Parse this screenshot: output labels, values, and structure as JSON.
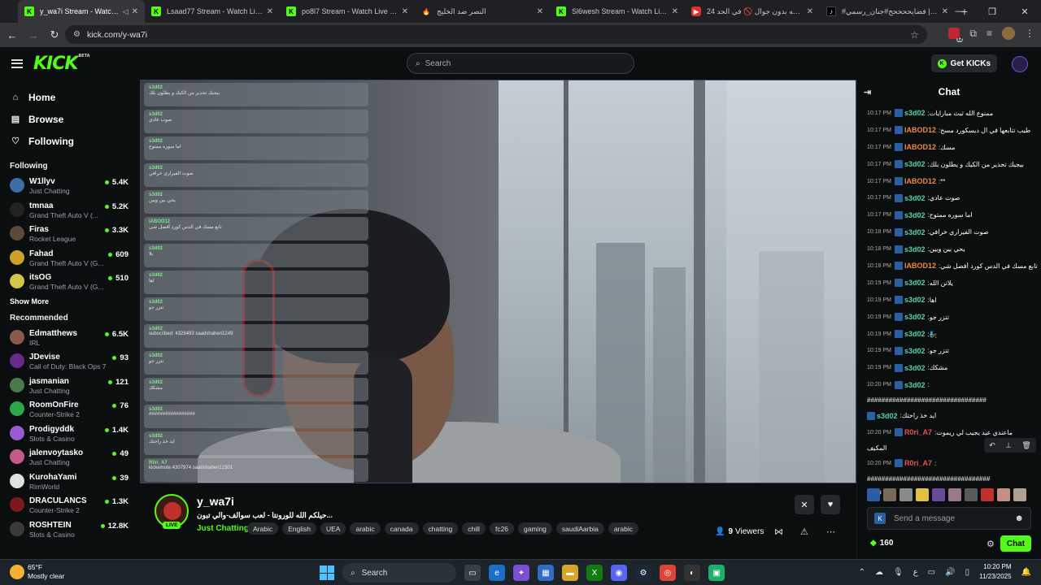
{
  "browser": {
    "tabs": [
      {
        "title": "y_wa7i Stream - Watch Live o",
        "icon": "kick-icon",
        "active": true
      },
      {
        "title": "Lsaad77 Stream - Watch Live o",
        "icon": "kick-icon"
      },
      {
        "title": "po8l7 Stream - Watch Live on K",
        "icon": "kick-icon"
      },
      {
        "title": "النصر ضد الخليج",
        "icon": "fire-icon"
      },
      {
        "title": "Sl6wesh Stream - Watch Live o",
        "icon": "kick-icon"
      },
      {
        "title": "24 ساعه بدون جوال 🚫 في الحد",
        "icon": "youtube-icon"
      },
      {
        "title": "#فضايححححح#جنان_رسمي | Tok",
        "icon": "tiktok-icon"
      }
    ],
    "url": "kick.com/y-wa7i",
    "ext_badge": "12"
  },
  "kick": {
    "logo": "KICK",
    "logo_sup": "BETA",
    "search_placeholder": "Search",
    "get_kicks": "Get KICKs"
  },
  "sidebar": {
    "nav": [
      {
        "label": "Home",
        "icon": "home-icon"
      },
      {
        "label": "Browse",
        "icon": "browse-icon"
      },
      {
        "label": "Following",
        "icon": "heart-icon"
      }
    ],
    "following_heading": "Following",
    "following": [
      {
        "name": "W1llyv",
        "category": "Just Chatting",
        "viewers": "5.4K",
        "color": "#3a6ea5"
      },
      {
        "name": "tmnaa",
        "category": "Grand Theft Auto V (...",
        "viewers": "5.2K",
        "color": "#222222"
      },
      {
        "name": "Firas",
        "category": "Rocket League",
        "viewers": "3.3K",
        "color": "#5a4a3a"
      },
      {
        "name": "Fahad",
        "category": "Grand Theft Auto V (G...",
        "viewers": "609",
        "color": "#c9a227"
      },
      {
        "name": "itsOG",
        "category": "Grand Theft Auto V (G...",
        "viewers": "510",
        "color": "#d4c44a"
      }
    ],
    "show_more": "Show More",
    "recommended_heading": "Recommended",
    "recommended": [
      {
        "name": "Edmatthews",
        "category": "IRL",
        "viewers": "6.5K",
        "color": "#8a5a4a"
      },
      {
        "name": "JDevise",
        "category": "Call of Duty: Black Ops 7",
        "viewers": "93",
        "color": "#6a2a8a"
      },
      {
        "name": "jasmanian",
        "category": "Just Chatting",
        "viewers": "121",
        "color": "#4a7a4a"
      },
      {
        "name": "RoomOnFire",
        "category": "Counter-Strike 2",
        "viewers": "76",
        "color": "#2aa84a"
      },
      {
        "name": "Prodigyddk",
        "category": "Slots & Casino",
        "viewers": "1.4K",
        "color": "#9a5ad4"
      },
      {
        "name": "jalenvoytasko",
        "category": "Just Chatting",
        "viewers": "49",
        "color": "#c45a8a"
      },
      {
        "name": "KurohaYami",
        "category": "RimWorld",
        "viewers": "39",
        "color": "#e0e0e0"
      },
      {
        "name": "DRACULANCS",
        "category": "Counter-Strike 2",
        "viewers": "1.3K",
        "color": "#7a1a1a"
      },
      {
        "name": "ROSHTEIN",
        "category": "Slots & Casino",
        "viewers": "12.8K",
        "color": "#3a3a3a"
      }
    ]
  },
  "video_overlay": [
    {
      "user": "s3d02",
      "text": "بيجيك تحذير من الكيك و يطلون بلك"
    },
    {
      "user": "s3d02",
      "text": "صوت عادي"
    },
    {
      "user": "s3d02",
      "text": "اما سوره ممتوح"
    },
    {
      "user": "s3d02",
      "text": "صوت الفيراري خرافي"
    },
    {
      "user": "s3d02",
      "text": "يحي بين ويين"
    },
    {
      "user": "IABOD12",
      "text": "تابع مسك في الدس كورد أفضل شي"
    },
    {
      "user": "s3d02",
      "text": "يلا"
    },
    {
      "user": "s3d02",
      "text": "اها"
    },
    {
      "user": "s3d02",
      "text": "تتزر جو"
    },
    {
      "user": "s3d02",
      "text": "subscribed: 4328493 saadshaheri1249"
    },
    {
      "user": "s3d02",
      "text": "تتزر جو"
    },
    {
      "user": "s3d02",
      "text": "مشكك"
    },
    {
      "user": "s3d02",
      "text": "#################"
    },
    {
      "user": "s3d02",
      "text": "ايد خذ راحتك"
    },
    {
      "user": "R0ri_A7",
      "text": "kickemote:4307974 saadshaheri12301"
    }
  ],
  "stream": {
    "name": "y_wa7i",
    "live": "LIVE",
    "title": "حيلكم الله للورونتا - لعب سوالف-والي تبون...",
    "category": "Just Chatting",
    "tags": [
      "Arabic",
      "English",
      "UEA",
      "arabic",
      "canada",
      "chatting",
      "chill",
      "fc26",
      "gaming",
      "saudiAarbia",
      "arabic"
    ],
    "viewers_count": "9",
    "viewers_label": "Viewers"
  },
  "chat": {
    "title": "Chat",
    "messages": [
      {
        "time": "10:17 PM",
        "user": "s3d02",
        "color": "#53d4a8",
        "text": "ممنوع الله ثبث مبارايات"
      },
      {
        "time": "10:17 PM",
        "user": "IABOD12",
        "color": "#f0883e",
        "text": "طيب تتابعها في ال ديسكورد مسح"
      },
      {
        "time": "10:17 PM",
        "user": "IABOD12",
        "color": "#f0883e",
        "text": "مسك"
      },
      {
        "time": "10:17 PM",
        "user": "s3d02",
        "color": "#53d4a8",
        "text": "بيجيك تحذير من الكيك و يطلون بلك"
      },
      {
        "time": "10:17 PM",
        "user": "IABOD12",
        "color": "#f0883e",
        "text": "**"
      },
      {
        "time": "10:17 PM",
        "user": "s3d02",
        "color": "#53d4a8",
        "text": "صوت عادي"
      },
      {
        "time": "10:17 PM",
        "user": "s3d02",
        "color": "#53d4a8",
        "text": "اما سوره ممتوح"
      },
      {
        "time": "10:18 PM",
        "user": "s3d02",
        "color": "#53d4a8",
        "text": "صوت الفيراري خرافي"
      },
      {
        "time": "10:18 PM",
        "user": "s3d02",
        "color": "#53d4a8",
        "text": "يحي بين ويين"
      },
      {
        "time": "10:18 PM",
        "user": "IABOD12",
        "color": "#f0883e",
        "text": "تابع مسك في الدس كورد أفضل شي"
      },
      {
        "time": "10:19 PM",
        "user": "s3d02",
        "color": "#53d4a8",
        "text": "يلاتن الله"
      },
      {
        "time": "10:19 PM",
        "user": "s3d02",
        "color": "#53d4a8",
        "text": "اها"
      },
      {
        "time": "10:19 PM",
        "user": "s3d02",
        "color": "#53d4a8",
        "text": "تتزر جو"
      },
      {
        "time": "10:19 PM",
        "user": "s3d02",
        "color": "#53d4a8",
        "text": "🧞"
      },
      {
        "time": "10:19 PM",
        "user": "s3d02",
        "color": "#53d4a8",
        "text": "تتزر جو"
      },
      {
        "time": "10:19 PM",
        "user": "s3d02",
        "color": "#53d4a8",
        "text": "مشكك"
      },
      {
        "time": "10:20 PM",
        "user": "s3d02",
        "color": "#53d4a8",
        "text": ""
      }
    ],
    "long1": "#################################",
    "msg_after": {
      "user": "s3d02",
      "color": "#53d4a8",
      "text": "ايد خذ راحتك"
    },
    "msg_r0ri1": {
      "time": "10:20 PM",
      "user": "R0ri_A7",
      "color": "#e5534b",
      "text": "ماعندي عيد يجيب لي ريموت"
    },
    "msg_r0ri1_wrap": "المكيف",
    "msg_r0ri2": {
      "time": "10:20 PM",
      "user": "R0ri_A7",
      "color": "#e5534b",
      "text": ""
    },
    "long2": "##################################",
    "long2_tail": "####",
    "input_placeholder": "Send a message",
    "points": "160",
    "send_button": "Chat"
  },
  "taskbar": {
    "temp": "65°F",
    "weather": "Mostly clear",
    "search": "Search",
    "lang": "ع",
    "time": "10:20 PM",
    "date": "11/23/2025"
  }
}
